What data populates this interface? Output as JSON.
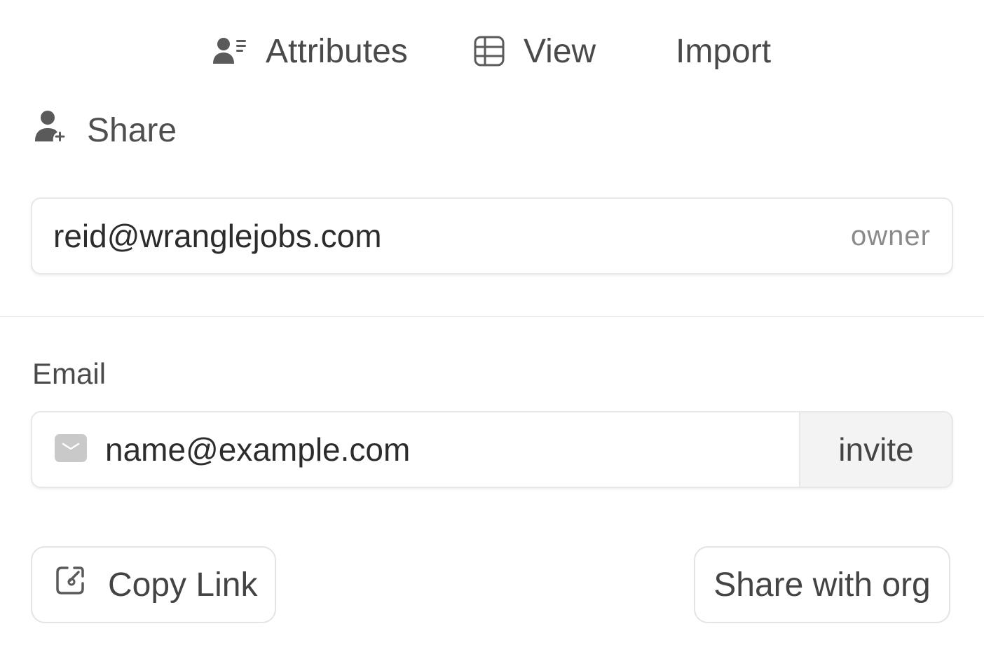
{
  "tabs": {
    "attributes": {
      "label": "Attributes",
      "icon": "user-list-icon"
    },
    "view": {
      "label": "View",
      "icon": "table-icon"
    },
    "import": {
      "label": "Import"
    }
  },
  "share": {
    "title": "Share",
    "icon": "user-add-icon",
    "owner": {
      "email": "reid@wranglejobs.com",
      "role": "owner"
    },
    "email_label": "Email",
    "invite": {
      "placeholder": "name@example.com",
      "icon": "envelope-icon",
      "button_label": "invite"
    },
    "copy_link": {
      "label": "Copy Link",
      "icon": "link-icon"
    },
    "share_org": {
      "label": "Share with org"
    }
  },
  "colors": {
    "text": "#3a3a3a",
    "muted": "#8a8a8a",
    "border": "#e7e7e7",
    "button_bg": "#f3f3f3"
  }
}
